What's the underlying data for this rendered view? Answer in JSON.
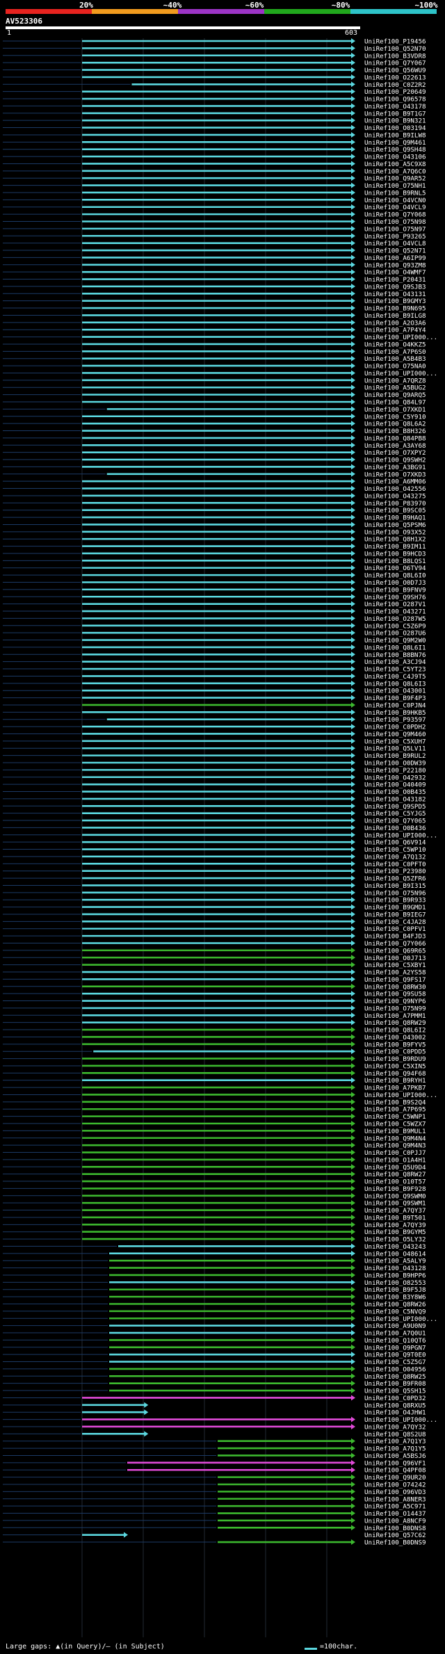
{
  "query": {
    "name": "AV523306",
    "start": "1",
    "end": "603"
  },
  "legend": {
    "colors": [
      "#e8231f",
      "#f29b1e",
      "#9c34c6",
      "#21a81d",
      "#2ec4c9"
    ],
    "labels": [
      "20%",
      "~40%",
      "~60%",
      "~80%",
      "~100%"
    ]
  },
  "hit_palette": {
    "c": "#5bd8e0",
    "g": "#3cb82e",
    "m": "#e04ad8"
  },
  "hits": [
    [
      "UniRef100_P19456",
      "c",
      0,
      603,
      0
    ],
    [
      "UniRef100_Q52N70",
      "c",
      0,
      603,
      0
    ],
    [
      "UniRef100_B3VDR8",
      "c",
      0,
      603,
      0
    ],
    [
      "UniRef100_Q7Y067",
      "c",
      0,
      603,
      0
    ],
    [
      "UniRef100_Q56WU9",
      "c",
      0,
      603,
      0
    ],
    [
      "UniRef100_O22613",
      "c",
      0,
      603,
      0
    ],
    [
      "UniRef100_C0Z2R2",
      "c",
      110,
      603,
      0
    ],
    [
      "UniRef100_P20649",
      "c",
      0,
      603,
      0
    ],
    [
      "UniRef100_Q96578",
      "c",
      0,
      603,
      0
    ],
    [
      "UniRef100_O43178",
      "c",
      0,
      603,
      0
    ],
    [
      "UniRef100_B9T1G7",
      "c",
      0,
      603,
      0
    ],
    [
      "UniRef100_B9N321",
      "c",
      0,
      603,
      0
    ],
    [
      "UniRef100_O03194",
      "c",
      0,
      603,
      0
    ],
    [
      "UniRef100_B9ILW8",
      "c",
      0,
      603,
      0
    ],
    [
      "UniRef100_Q9M461",
      "c",
      0,
      603,
      0
    ],
    [
      "UniRef100_Q9SH48",
      "c",
      0,
      603,
      0
    ],
    [
      "UniRef100_O43106",
      "c",
      0,
      603,
      0
    ],
    [
      "UniRef100_A5C9X8",
      "c",
      0,
      603,
      0
    ],
    [
      "UniRef100_A7Q6C0",
      "c",
      0,
      603,
      0
    ],
    [
      "UniRef100_Q9AR52",
      "c",
      0,
      603,
      0
    ],
    [
      "UniRef100_O75NH1",
      "c",
      0,
      603,
      0
    ],
    [
      "UniRef100_B9RNL5",
      "c",
      0,
      603,
      0
    ],
    [
      "UniRef100_O4VCN0",
      "c",
      0,
      603,
      0
    ],
    [
      "UniRef100_O4VCL9",
      "c",
      0,
      603,
      0
    ],
    [
      "UniRef100_Q7Y068",
      "c",
      0,
      603,
      0
    ],
    [
      "UniRef100_O75N98",
      "c",
      0,
      603,
      0
    ],
    [
      "UniRef100_O75N97",
      "c",
      0,
      603,
      0
    ],
    [
      "UniRef100_P93265",
      "c",
      0,
      603,
      0
    ],
    [
      "UniRef100_O4VCL8",
      "c",
      0,
      603,
      0
    ],
    [
      "UniRef100_Q52N71",
      "c",
      0,
      603,
      0
    ],
    [
      "UniRef100_A6IP99",
      "c",
      0,
      603,
      0
    ],
    [
      "UniRef100_Q93ZM8",
      "c",
      0,
      603,
      0
    ],
    [
      "UniRef100_O4WMF7",
      "c",
      0,
      603,
      0
    ],
    [
      "UniRef100_P20431",
      "c",
      0,
      603,
      0
    ],
    [
      "UniRef100_Q9SJB3",
      "c",
      0,
      603,
      0
    ],
    [
      "UniRef100_O43131",
      "c",
      0,
      603,
      0
    ],
    [
      "UniRef100_B9GMY3",
      "c",
      0,
      603,
      0
    ],
    [
      "UniRef100_B9N695",
      "c",
      0,
      603,
      0
    ],
    [
      "UniRef100_B9ILG8",
      "c",
      0,
      603,
      0
    ],
    [
      "UniRef100_A2O3A6",
      "c",
      0,
      603,
      0
    ],
    [
      "UniRef100_A7P4Y4",
      "c",
      0,
      603,
      0
    ],
    [
      "UniRef100_UPI000...",
      "c",
      0,
      603,
      0
    ],
    [
      "UniRef100_O4KKZ5",
      "c",
      0,
      603,
      0
    ],
    [
      "UniRef100_A7P6S0",
      "c",
      0,
      603,
      0
    ],
    [
      "UniRef100_A5B4B3",
      "c",
      0,
      603,
      0
    ],
    [
      "UniRef100_O75NA0",
      "c",
      0,
      603,
      0
    ],
    [
      "UniRef100_UPI000...",
      "c",
      0,
      603,
      0
    ],
    [
      "UniRef100_A7QRZ8",
      "c",
      0,
      603,
      0
    ],
    [
      "UniRef100_A5BUG2",
      "c",
      0,
      603,
      0
    ],
    [
      "UniRef100_Q9ARQ5",
      "c",
      0,
      603,
      0
    ],
    [
      "UniRef100_Q84L97",
      "c",
      0,
      603,
      0
    ],
    [
      "UniRef100_O7XKD1",
      "c",
      55,
      603,
      0
    ],
    [
      "UniRef100_C5Y910",
      "c",
      0,
      603,
      0
    ],
    [
      "UniRef100_Q8L6A2",
      "c",
      0,
      603,
      0
    ],
    [
      "UniRef100_B8H326",
      "c",
      0,
      603,
      0
    ],
    [
      "UniRef100_Q84PB8",
      "c",
      0,
      603,
      0
    ],
    [
      "UniRef100_A3AY68",
      "c",
      0,
      603,
      0
    ],
    [
      "UniRef100_O7XPY2",
      "c",
      0,
      603,
      0
    ],
    [
      "UniRef100_Q9SWH2",
      "c",
      0,
      603,
      0
    ],
    [
      "UniRef100_A3BG91",
      "c",
      0,
      603,
      0
    ],
    [
      "UniRef100_O7XKD3",
      "c",
      55,
      603,
      0
    ],
    [
      "UniRef100_A6MM06",
      "c",
      0,
      603,
      0
    ],
    [
      "UniRef100_O42556",
      "c",
      0,
      603,
      0
    ],
    [
      "UniRef100_O43275",
      "c",
      0,
      603,
      0
    ],
    [
      "UniRef100_P83970",
      "c",
      0,
      603,
      0
    ],
    [
      "UniRef100_B9SC05",
      "c",
      0,
      603,
      0
    ],
    [
      "UniRef100_B9HAQ1",
      "c",
      0,
      603,
      0
    ],
    [
      "UniRef100_Q5PSM6",
      "c",
      0,
      603,
      0
    ],
    [
      "UniRef100_O93X52",
      "c",
      0,
      603,
      0
    ],
    [
      "UniRef100_Q8H1X2",
      "c",
      0,
      603,
      0
    ],
    [
      "UniRef100_B9IM11",
      "c",
      0,
      603,
      0
    ],
    [
      "UniRef100_B9HCD3",
      "c",
      0,
      603,
      0
    ],
    [
      "UniRef100_B8LQS1",
      "c",
      0,
      603,
      0
    ],
    [
      "UniRef100_O6TV94",
      "c",
      0,
      603,
      0
    ],
    [
      "UniRef100_Q8L6I0",
      "c",
      0,
      603,
      0
    ],
    [
      "UniRef100_O0D7J3",
      "c",
      0,
      603,
      0
    ],
    [
      "UniRef100_B9FNV9",
      "c",
      0,
      603,
      0
    ],
    [
      "UniRef100_Q9SH76",
      "c",
      0,
      603,
      0
    ],
    [
      "UniRef100_O287V1",
      "c",
      0,
      603,
      0
    ],
    [
      "UniRef100_O43271",
      "c",
      0,
      603,
      0
    ],
    [
      "UniRef100_O287W5",
      "c",
      0,
      603,
      0
    ],
    [
      "UniRef100_C5Z6P9",
      "c",
      0,
      603,
      0
    ],
    [
      "UniRef100_O287U6",
      "c",
      0,
      603,
      0
    ],
    [
      "UniRef100_Q9M2W0",
      "c",
      0,
      603,
      0
    ],
    [
      "UniRef100_Q8L6I1",
      "c",
      0,
      603,
      0
    ],
    [
      "UniRef100_B8BN76",
      "c",
      0,
      603,
      0
    ],
    [
      "UniRef100_A3CJ94",
      "c",
      0,
      603,
      0
    ],
    [
      "UniRef100_C5YT23",
      "c",
      0,
      603,
      0
    ],
    [
      "UniRef100_C4J9T5",
      "c",
      0,
      603,
      0
    ],
    [
      "UniRef100_Q8L6I3",
      "c",
      0,
      603,
      0
    ],
    [
      "UniRef100_O43001",
      "c",
      0,
      603,
      0
    ],
    [
      "UniRef100_B9F4P3",
      "c",
      0,
      603,
      0
    ],
    [
      "UniRef100_C0PJN4",
      "g",
      0,
      603,
      0
    ],
    [
      "UniRef100_B9HKB5",
      "c",
      0,
      603,
      0
    ],
    [
      "UniRef100_P93597",
      "c",
      55,
      603,
      0
    ],
    [
      "UniRef100_C0PDH2",
      "c",
      0,
      603,
      0
    ],
    [
      "UniRef100_Q9M460",
      "c",
      0,
      603,
      0
    ],
    [
      "UniRef100_C5XUH7",
      "c",
      0,
      603,
      0
    ],
    [
      "UniRef100_Q5LV11",
      "c",
      0,
      603,
      0
    ],
    [
      "UniRef100_B9RUL2",
      "c",
      0,
      603,
      0
    ],
    [
      "UniRef100_O0DW39",
      "c",
      0,
      603,
      0
    ],
    [
      "UniRef100_P22180",
      "c",
      0,
      603,
      0
    ],
    [
      "UniRef100_O42932",
      "c",
      0,
      603,
      0
    ],
    [
      "UniRef100_O40409",
      "c",
      0,
      603,
      0
    ],
    [
      "UniRef100_O0B435",
      "c",
      0,
      603,
      0
    ],
    [
      "UniRef100_O43182",
      "c",
      0,
      603,
      0
    ],
    [
      "UniRef100_Q9SPD5",
      "c",
      0,
      603,
      0
    ],
    [
      "UniRef100_C5YJG5",
      "c",
      0,
      603,
      0
    ],
    [
      "UniRef100_Q7Y065",
      "c",
      0,
      603,
      0
    ],
    [
      "UniRef100_O0B436",
      "c",
      0,
      603,
      0
    ],
    [
      "UniRef100_UPI000...",
      "c",
      0,
      603,
      0
    ],
    [
      "UniRef100_Q6V914",
      "c",
      0,
      603,
      0
    ],
    [
      "UniRef100_C5WP10",
      "c",
      0,
      603,
      0
    ],
    [
      "UniRef100_A7Q132",
      "c",
      0,
      603,
      0
    ],
    [
      "UniRef100_C0PFT0",
      "c",
      0,
      603,
      0
    ],
    [
      "UniRef100_P23980",
      "c",
      0,
      603,
      0
    ],
    [
      "UniRef100_Q5ZFR6",
      "c",
      0,
      603,
      0
    ],
    [
      "UniRef100_B9I315",
      "c",
      0,
      603,
      0
    ],
    [
      "UniRef100_O75N96",
      "c",
      0,
      603,
      0
    ],
    [
      "UniRef100_B9R933",
      "c",
      0,
      603,
      0
    ],
    [
      "UniRef100_B9GMD1",
      "c",
      0,
      603,
      0
    ],
    [
      "UniRef100_B9IEG7",
      "c",
      0,
      603,
      0
    ],
    [
      "UniRef100_C4JA28",
      "c",
      0,
      603,
      0
    ],
    [
      "UniRef100_C0PFV1",
      "c",
      0,
      603,
      0
    ],
    [
      "UniRef100_B4FJD3",
      "c",
      0,
      603,
      0
    ],
    [
      "UniRef100_Q7Y066",
      "c",
      0,
      603,
      0
    ],
    [
      "UniRef100_Q69R65",
      "g",
      0,
      603,
      0
    ],
    [
      "UniRef100_O0J713",
      "g",
      0,
      603,
      0
    ],
    [
      "UniRef100_C5XBY1",
      "g",
      0,
      603,
      0
    ],
    [
      "UniRef100_A2YS58",
      "c",
      0,
      603,
      0
    ],
    [
      "UniRef100_Q9FS17",
      "c",
      0,
      603,
      0
    ],
    [
      "UniRef100_Q8RW30",
      "g",
      0,
      603,
      0
    ],
    [
      "UniRef100_Q9SU58",
      "c",
      0,
      603,
      0
    ],
    [
      "UniRef100_Q9NYP6",
      "c",
      0,
      603,
      0
    ],
    [
      "UniRef100_O75N99",
      "c",
      0,
      603,
      0
    ],
    [
      "UniRef100_A7PMM1",
      "c",
      0,
      603,
      0
    ],
    [
      "UniRef100_Q8RW29",
      "c",
      0,
      603,
      0
    ],
    [
      "UniRef100_Q8L6I2",
      "g",
      0,
      603,
      0
    ],
    [
      "UniRef100_O43002",
      "g",
      0,
      603,
      0
    ],
    [
      "UniRef100_B9FYV5",
      "g",
      0,
      603,
      0
    ],
    [
      "UniRef100_C0PDD5",
      "c",
      25,
      603,
      0
    ],
    [
      "UniRef100_B9RDU9",
      "g",
      0,
      603,
      0
    ],
    [
      "UniRef100_C5XIN5",
      "g",
      0,
      603,
      0
    ],
    [
      "UniRef100_Q94F68",
      "g",
      0,
      603,
      0
    ],
    [
      "UniRef100_B9RYH1",
      "c",
      0,
      603,
      0
    ],
    [
      "UniRef100_A7PKB7",
      "g",
      0,
      603,
      0
    ],
    [
      "UniRef100_UPI000...",
      "g",
      0,
      603,
      0
    ],
    [
      "UniRef100_B9S2Q4",
      "g",
      0,
      603,
      0
    ],
    [
      "UniRef100_A7P695",
      "g",
      0,
      603,
      0
    ],
    [
      "UniRef100_C5WNP1",
      "g",
      0,
      603,
      0
    ],
    [
      "UniRef100_C5WZX7",
      "g",
      0,
      603,
      0
    ],
    [
      "UniRef100_B9MUL1",
      "g",
      0,
      603,
      0
    ],
    [
      "UniRef100_Q9M4N4",
      "g",
      0,
      603,
      0
    ],
    [
      "UniRef100_Q9M4N3",
      "g",
      0,
      603,
      0
    ],
    [
      "UniRef100_C0PJJ7",
      "g",
      0,
      603,
      0
    ],
    [
      "UniRef100_O1A4H1",
      "g",
      0,
      603,
      0
    ],
    [
      "UniRef100_Q5U9D4",
      "g",
      0,
      603,
      0
    ],
    [
      "UniRef100_Q8RW27",
      "g",
      0,
      603,
      0
    ],
    [
      "UniRef100_O10T57",
      "g",
      0,
      603,
      0
    ],
    [
      "UniRef100_B9F928",
      "g",
      0,
      603,
      0
    ],
    [
      "UniRef100_Q9SWM0",
      "g",
      0,
      603,
      0
    ],
    [
      "UniRef100_Q9SWM1",
      "g",
      0,
      603,
      0
    ],
    [
      "UniRef100_A7QY37",
      "g",
      0,
      603,
      0
    ],
    [
      "UniRef100_B9T501",
      "g",
      0,
      603,
      0
    ],
    [
      "UniRef100_A7QY39",
      "g",
      0,
      603,
      0
    ],
    [
      "UniRef100_B9GYM5",
      "g",
      0,
      603,
      0
    ],
    [
      "UniRef100_O5LY32",
      "g",
      0,
      603,
      0
    ],
    [
      "UniRef100_O43243",
      "c",
      80,
      603,
      0
    ],
    [
      "UniRef100_O48614",
      "c",
      60,
      603,
      0
    ],
    [
      "UniRef100_A5ALY9",
      "g",
      60,
      603,
      0
    ],
    [
      "UniRef100_O43128",
      "g",
      60,
      603,
      0
    ],
    [
      "UniRef100_B9HPP6",
      "g",
      60,
      603,
      0
    ],
    [
      "UniRef100_O82553",
      "c",
      60,
      603,
      0
    ],
    [
      "UniRef100_B9F5J8",
      "g",
      60,
      603,
      0
    ],
    [
      "UniRef100_B3Y8W6",
      "g",
      60,
      603,
      0
    ],
    [
      "UniRef100_Q8RW26",
      "g",
      60,
      603,
      0
    ],
    [
      "UniRef100_C5NVQ9",
      "g",
      60,
      603,
      0
    ],
    [
      "UniRef100_UPI000...",
      "g",
      60,
      603,
      0
    ],
    [
      "UniRef100_A9U0N9",
      "c",
      60,
      603,
      0
    ],
    [
      "UniRef100_A7Q0U1",
      "c",
      60,
      603,
      0
    ],
    [
      "UniRef100_Q10QT6",
      "g",
      60,
      603,
      0
    ],
    [
      "UniRef100_O9PGN7",
      "g",
      60,
      603,
      0
    ],
    [
      "UniRef100_Q9T0E0",
      "c",
      60,
      603,
      0
    ],
    [
      "UniRef100_C5Z5G7",
      "c",
      60,
      603,
      0
    ],
    [
      "UniRef100_O04956",
      "g",
      60,
      603,
      0
    ],
    [
      "UniRef100_Q8RW25",
      "g",
      60,
      603,
      0
    ],
    [
      "UniRef100_B9FR08",
      "g",
      60,
      603,
      0
    ],
    [
      "UniRef100_Q5SH15",
      "g",
      60,
      603,
      0
    ],
    [
      "UniRef100_C0PD32",
      "m",
      0,
      603,
      0
    ],
    [
      "UniRef100_Q8RXU5",
      "c",
      0,
      145,
      0
    ],
    [
      "UniRef100_O4JHW1",
      "c",
      0,
      145,
      0
    ],
    [
      "UniRef100_UPI000...",
      "m",
      0,
      603,
      0
    ],
    [
      "UniRef100_A7QY32",
      "m",
      0,
      603,
      0
    ],
    [
      "UniRef100_Q8S2U8",
      "c",
      0,
      145,
      0
    ],
    [
      "UniRef100_A7Q1Y3",
      "g",
      300,
      603,
      0
    ],
    [
      "UniRef100_A7Q1Y5",
      "g",
      300,
      603,
      0
    ],
    [
      "UniRef100_A5BSJ6",
      "g",
      300,
      603,
      0
    ],
    [
      "UniRef100_Q96VF1",
      "m",
      100,
      603,
      0
    ],
    [
      "UniRef100_Q4PF08",
      "m",
      100,
      603,
      0
    ],
    [
      "UniRef100_Q9UR20",
      "g",
      300,
      603,
      0
    ],
    [
      "UniRef100_O74242",
      "g",
      300,
      603,
      0
    ],
    [
      "UniRef100_O96VD3",
      "g",
      300,
      603,
      0
    ],
    [
      "UniRef100_A8NER3",
      "g",
      300,
      603,
      0
    ],
    [
      "UniRef100_A5C971",
      "g",
      300,
      603,
      0
    ],
    [
      "UniRef100_O14437",
      "g",
      300,
      603,
      0
    ],
    [
      "UniRef100_A8NCF9",
      "g",
      300,
      603,
      0
    ],
    [
      "UniRef100_B0DNS8",
      "g",
      300,
      603,
      0
    ],
    [
      "UniRef100_Q57C62",
      "c",
      0,
      100,
      0
    ],
    [
      "UniRef100_B0DNS9",
      "g",
      300,
      603,
      0
    ]
  ],
  "footer": {
    "gaps_label": "Large gaps: ▲(in Query)/– (in Subject)",
    "scale_label": "=100char."
  }
}
